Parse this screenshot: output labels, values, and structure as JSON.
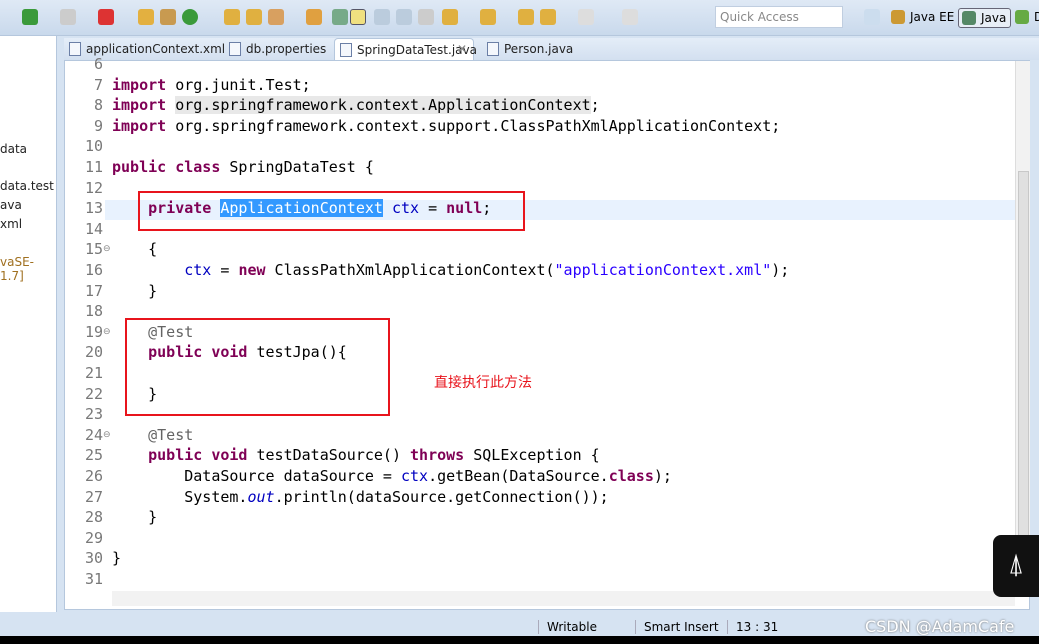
{
  "toolbar": {
    "quick_access_placeholder": "Quick Access",
    "perspectives": [
      "Java EE",
      "Java",
      "D"
    ]
  },
  "left_panel": {
    "items": [
      "data",
      "data.test",
      "ava",
      "xml",
      "vaSE-1.7]"
    ]
  },
  "tabs": [
    {
      "label": "applicationContext.xml",
      "icon": "xml-file-icon"
    },
    {
      "label": "db.properties",
      "icon": "properties-file-icon"
    },
    {
      "label": "SpringDataTest.java",
      "icon": "java-file-icon",
      "active": true
    },
    {
      "label": "Person.java",
      "icon": "java-file-icon"
    }
  ],
  "code": [
    {
      "n": "6",
      "t": []
    },
    {
      "n": "7",
      "t": [
        [
          "import",
          "kw"
        ],
        [
          " org.junit.Test;",
          ""
        ]
      ]
    },
    {
      "n": "8",
      "t": [
        [
          "import",
          "kw"
        ],
        [
          " ",
          ""
        ],
        [
          "org.springframework.context.ApplicationContext",
          "gray"
        ],
        [
          ";",
          ""
        ]
      ]
    },
    {
      "n": "9",
      "t": [
        [
          "import",
          "kw"
        ],
        [
          " org.springframework.context.support.ClassPathXmlApplicationContext;",
          ""
        ]
      ]
    },
    {
      "n": "10",
      "t": []
    },
    {
      "n": "11",
      "t": [
        [
          "public class",
          "kw"
        ],
        [
          " SpringDataTest {",
          ""
        ]
      ]
    },
    {
      "n": "12",
      "t": []
    },
    {
      "n": "13",
      "t": [
        [
          "    ",
          ""
        ],
        [
          "private",
          "kw"
        ],
        [
          " ",
          ""
        ],
        [
          "ApplicationContext",
          "sel"
        ],
        [
          " ",
          ""
        ],
        [
          "ctx",
          "fld"
        ],
        [
          " = ",
          ""
        ],
        [
          "null",
          "kw"
        ],
        [
          ";",
          ""
        ]
      ]
    },
    {
      "n": "14",
      "t": []
    },
    {
      "n": "15",
      "t": [
        [
          "    {",
          ""
        ]
      ]
    },
    {
      "n": "16",
      "t": [
        [
          "        ",
          ""
        ],
        [
          "ctx",
          "fld"
        ],
        [
          " = ",
          ""
        ],
        [
          "new",
          "kw"
        ],
        [
          " ClassPathXmlApplicationContext(",
          ""
        ],
        [
          "\"applicationContext.xml\"",
          "str"
        ],
        [
          ");",
          ""
        ]
      ]
    },
    {
      "n": "17",
      "t": [
        [
          "    }",
          ""
        ]
      ]
    },
    {
      "n": "18",
      "t": []
    },
    {
      "n": "19",
      "t": [
        [
          "    ",
          ""
        ],
        [
          "@Test",
          "ann"
        ]
      ]
    },
    {
      "n": "20",
      "t": [
        [
          "    ",
          ""
        ],
        [
          "public void",
          "kw"
        ],
        [
          " testJpa(){",
          ""
        ]
      ]
    },
    {
      "n": "21",
      "t": []
    },
    {
      "n": "22",
      "t": [
        [
          "    }",
          ""
        ]
      ]
    },
    {
      "n": "23",
      "t": []
    },
    {
      "n": "24",
      "t": [
        [
          "    ",
          ""
        ],
        [
          "@Test",
          "ann"
        ]
      ]
    },
    {
      "n": "25",
      "t": [
        [
          "    ",
          ""
        ],
        [
          "public void",
          "kw"
        ],
        [
          " testDataSource() ",
          ""
        ],
        [
          "throws",
          "kw"
        ],
        [
          " SQLException {",
          ""
        ]
      ]
    },
    {
      "n": "26",
      "t": [
        [
          "        DataSource dataSource = ",
          ""
        ],
        [
          "ctx",
          "fld"
        ],
        [
          ".getBean(DataSource.",
          ""
        ],
        [
          "class",
          "kw"
        ],
        [
          ");",
          ""
        ]
      ]
    },
    {
      "n": "27",
      "t": [
        [
          "        System.",
          ""
        ],
        [
          "out",
          "it2"
        ],
        [
          ".println(dataSource.getConnection());",
          ""
        ]
      ]
    },
    {
      "n": "28",
      "t": [
        [
          "    }",
          ""
        ]
      ]
    },
    {
      "n": "29",
      "t": []
    },
    {
      "n": "30",
      "t": [
        [
          "}",
          ""
        ]
      ]
    },
    {
      "n": "31",
      "t": []
    }
  ],
  "folds": [
    "15",
    "19",
    "24"
  ],
  "annotation": "直接执行此方法",
  "status": {
    "writable": "Writable",
    "insert_mode": "Smart Insert",
    "position": "13 : 31"
  },
  "watermark": "CSDN @AdamCafe",
  "colors": {
    "keyword": "#7f0055",
    "string": "#2a00ff",
    "field": "#0000c0",
    "highlight_box": "#e8141c"
  }
}
